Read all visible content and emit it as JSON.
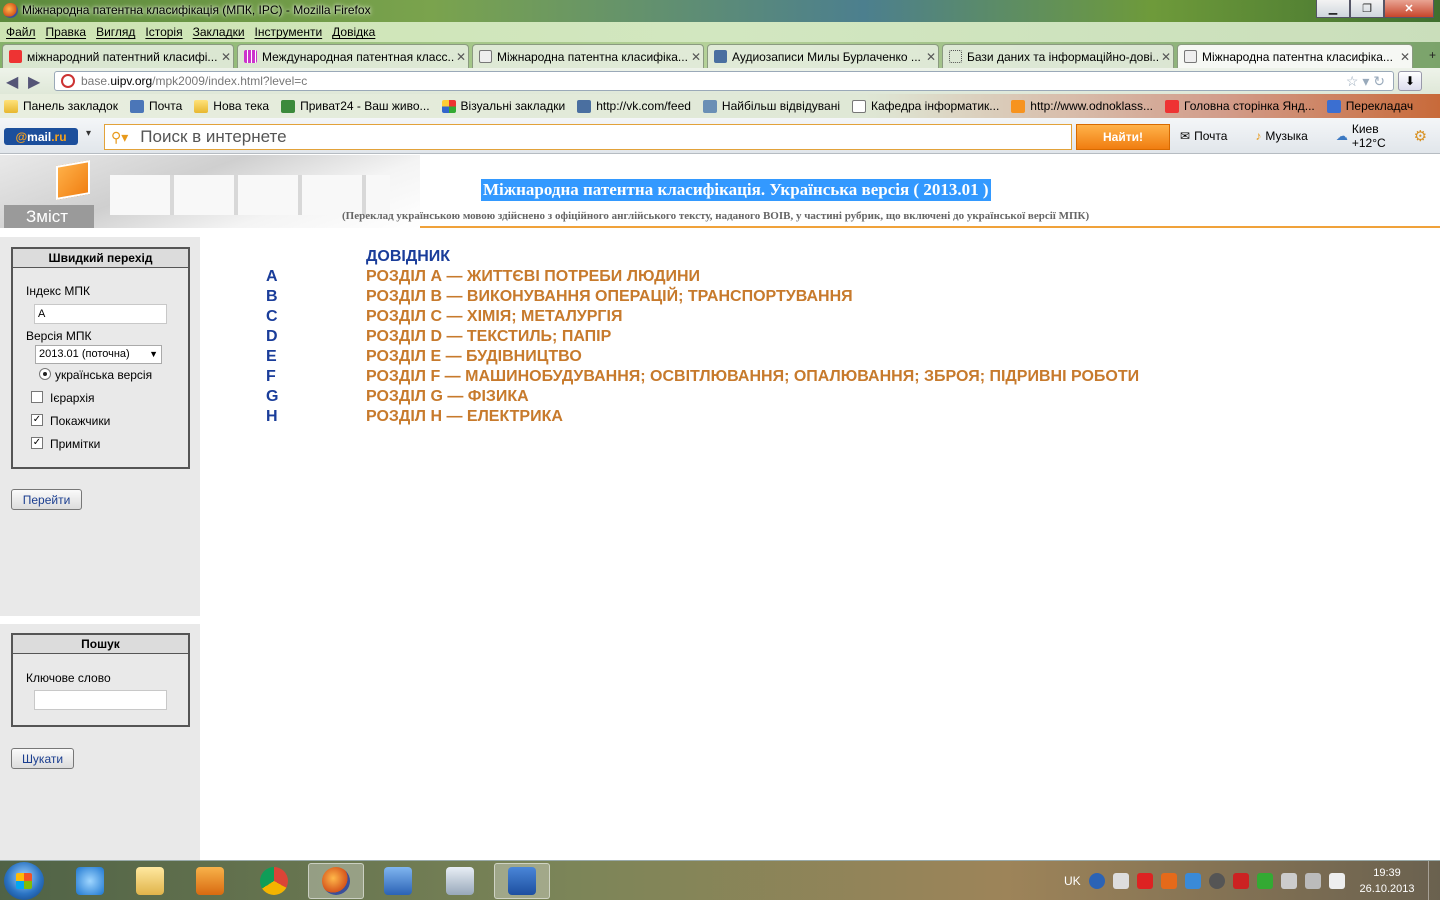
{
  "window": {
    "title": "Міжнародна патентна класифікація (МПК, IPC) - Mozilla Firefox"
  },
  "menu": [
    "Файл",
    "Правка",
    "Вигляд",
    "Історія",
    "Закладки",
    "Інструменти",
    "Довідка"
  ],
  "tabs": [
    {
      "label": "міжнародний патентний класифі...",
      "active": false
    },
    {
      "label": "Международная патентная класс...",
      "active": false
    },
    {
      "label": "Міжнародна патентна класифіка...",
      "active": false
    },
    {
      "label": "Аудиозаписи Милы Бурлаченко ...",
      "active": false
    },
    {
      "label": "Бази даних та інформаційно-дові...",
      "active": false
    },
    {
      "label": "Міжнародна патентна класифіка...",
      "active": true
    }
  ],
  "url": {
    "host_prefix": "base.",
    "host_main": "uipv.org",
    "path": "/mpk2009/index.html?level=c"
  },
  "bookmarks": [
    "Панель закладок",
    "Почта",
    "Нова тека",
    "Приват24 - Ваш живо...",
    "Візуальні закладки",
    "http://vk.com/feed",
    "Найбільш відвідувані",
    "Кафедра інформатик...",
    "http://www.odnoklass...",
    "Головна сторінка Янд...",
    "Перекладач"
  ],
  "mailru": {
    "logo_at": "@",
    "logo_main": "mail",
    "logo_dot": ".ru",
    "search_placeholder": "Поиск в интернете",
    "find_label": "Найти!",
    "mail_label": "Почта",
    "music_label": "Музыка",
    "weather_label": "Киев +12°C"
  },
  "page": {
    "contents_label": "Зміст",
    "title": "Міжнародна патентна класифікація. Українська версія ( 2013.01 )",
    "subtitle": "(Переклад українською мовою здійснено з офіційного англійського тексту, наданого ВОІВ, у частині рубрик, що включені до української версії МПК)"
  },
  "quick": {
    "heading": "Швидкий перехід",
    "index_label": "Індекс МПК",
    "index_value": "A",
    "version_label": "Версія МПК",
    "version_value": "2013.01 (поточна)",
    "ukr_label": "українська версія",
    "hierarchy_label": "Ієрархія",
    "hierarchy_checked": false,
    "indexes_label": "Покажчики",
    "indexes_checked": true,
    "notes_label": "Примітки",
    "notes_checked": true,
    "go_label": "Перейти"
  },
  "search": {
    "heading": "Пошук",
    "keyword_label": "Ключове слово",
    "keyword_value": "",
    "search_label": "Шукати"
  },
  "guide_label": "ДОВІДНИК",
  "sections": [
    {
      "code": "A",
      "name": "РОЗДІЛ А — ЖИТТЄВІ ПОТРЕБИ ЛЮДИНИ"
    },
    {
      "code": "B",
      "name": "РОЗДІЛ В — ВИКОНУВАННЯ ОПЕРАЦІЙ; ТРАНСПОРТУВАННЯ"
    },
    {
      "code": "C",
      "name": "РОЗДІЛ С — ХІМІЯ; МЕТАЛУРГІЯ"
    },
    {
      "code": "D",
      "name": "РОЗДІЛ D — ТЕКСТИЛЬ; ПАПІР"
    },
    {
      "code": "E",
      "name": "РОЗДІЛ Е — БУДІВНИЦТВО"
    },
    {
      "code": "F",
      "name": "РОЗДІЛ F — МАШИНОБУДУВАННЯ; ОСВІТЛЮВАННЯ; ОПАЛЮВАННЯ; ЗБРОЯ; ПІДРИВНІ РОБОТИ"
    },
    {
      "code": "G",
      "name": "РОЗДІЛ G — ФІЗИКА"
    },
    {
      "code": "H",
      "name": "РОЗДІЛ Н — ЕЛЕКТРИКА"
    }
  ],
  "taskbar": {
    "lang": "UK",
    "time": "19:39",
    "date": "26.10.2013"
  },
  "colors": {
    "link_blue": "#1a3d9a",
    "section_orange": "#c77a2c",
    "accent": "#f07d10"
  }
}
